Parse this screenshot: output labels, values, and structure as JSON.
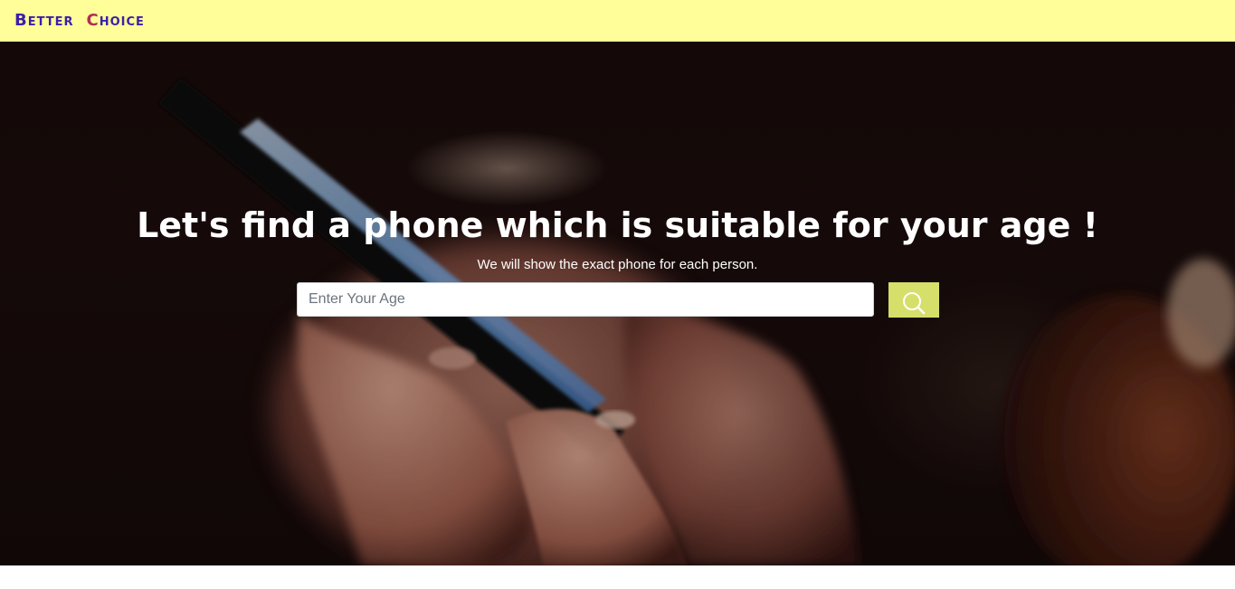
{
  "navbar": {
    "brand_word1": "Better",
    "brand_word2_first": "C",
    "brand_word2_rest": "hoice",
    "background_color": "#fffe99",
    "brand_color": "#3c1fa8",
    "brand_accent_color": "#b12f55"
  },
  "hero": {
    "headline": "Let's find a phone which is suitable for your age !",
    "subline": "We will show the exact phone for each person.",
    "background_image": "hands-holding-smartphone-photo"
  },
  "search": {
    "placeholder": "Enter Your Age",
    "value": "",
    "button_icon": "search-icon",
    "button_color": "#d5df6a"
  }
}
